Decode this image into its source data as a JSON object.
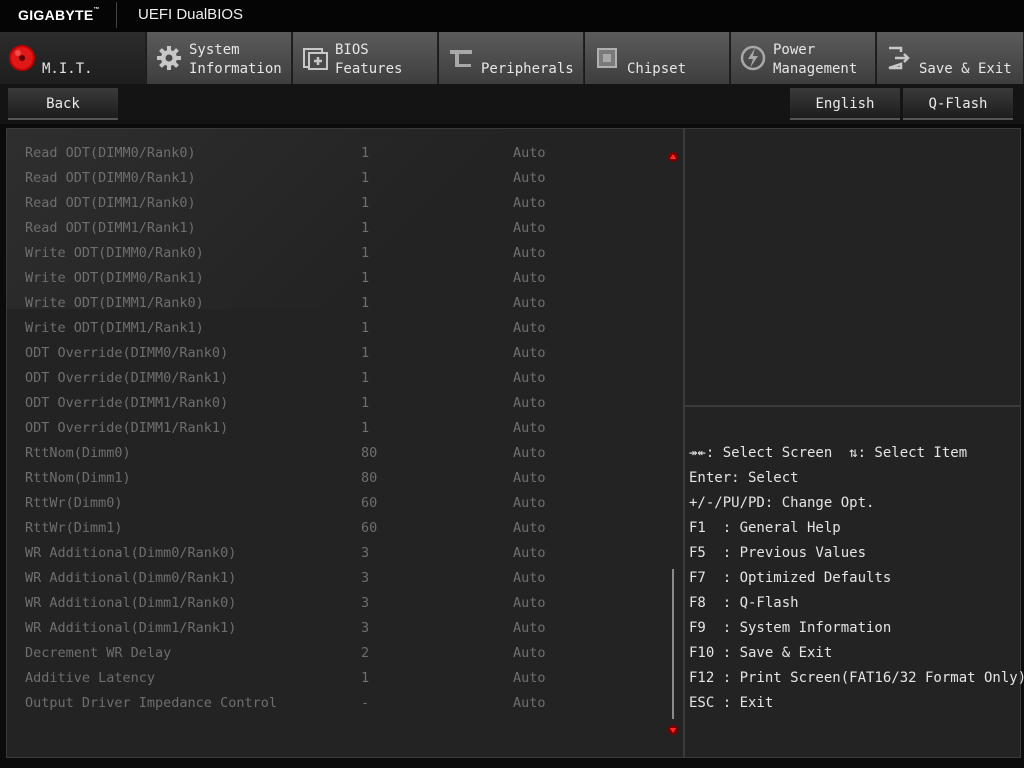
{
  "header": {
    "brand": "GIGABYTE",
    "brand_mark": "™",
    "product": "UEFI DualBIOS"
  },
  "tabs": [
    {
      "label1": "M.I.T.",
      "label2": "",
      "icon": "mit-disc-icon",
      "active": true
    },
    {
      "label1": "System",
      "label2": "Information",
      "icon": "gear-icon",
      "active": false
    },
    {
      "label1": "BIOS",
      "label2": "Features",
      "icon": "bios-chip-icon",
      "active": false
    },
    {
      "label1": "Peripherals",
      "label2": "",
      "icon": "peripherals-icon",
      "active": false
    },
    {
      "label1": "Chipset",
      "label2": "",
      "icon": "chipset-icon",
      "active": false
    },
    {
      "label1": "Power",
      "label2": "Management",
      "icon": "power-icon",
      "active": false
    },
    {
      "label1": "Save & Exit",
      "label2": "",
      "icon": "exit-icon",
      "active": false
    }
  ],
  "subbar": {
    "back_label": "Back",
    "language_label": "English",
    "qflash_label": "Q-Flash"
  },
  "settings": [
    {
      "name": "Read ODT(DIMM0/Rank0)",
      "current": "1",
      "setting": "Auto"
    },
    {
      "name": "Read ODT(DIMM0/Rank1)",
      "current": "1",
      "setting": "Auto"
    },
    {
      "name": "Read ODT(DIMM1/Rank0)",
      "current": "1",
      "setting": "Auto"
    },
    {
      "name": "Read ODT(DIMM1/Rank1)",
      "current": "1",
      "setting": "Auto"
    },
    {
      "name": "Write ODT(DIMM0/Rank0)",
      "current": "1",
      "setting": "Auto"
    },
    {
      "name": "Write ODT(DIMM0/Rank1)",
      "current": "1",
      "setting": "Auto"
    },
    {
      "name": "Write ODT(DIMM1/Rank0)",
      "current": "1",
      "setting": "Auto"
    },
    {
      "name": "Write ODT(DIMM1/Rank1)",
      "current": "1",
      "setting": "Auto"
    },
    {
      "name": "ODT Override(DIMM0/Rank0)",
      "current": "1",
      "setting": "Auto"
    },
    {
      "name": "ODT Override(DIMM0/Rank1)",
      "current": "1",
      "setting": "Auto"
    },
    {
      "name": "ODT Override(DIMM1/Rank0)",
      "current": "1",
      "setting": "Auto"
    },
    {
      "name": "ODT Override(DIMM1/Rank1)",
      "current": "1",
      "setting": "Auto"
    },
    {
      "name": "RttNom(Dimm0)",
      "current": "80",
      "setting": "Auto"
    },
    {
      "name": "RttNom(Dimm1)",
      "current": "80",
      "setting": "Auto"
    },
    {
      "name": "RttWr(Dimm0)",
      "current": "60",
      "setting": "Auto"
    },
    {
      "name": "RttWr(Dimm1)",
      "current": "60",
      "setting": "Auto"
    },
    {
      "name": "WR Additional(Dimm0/Rank0)",
      "current": "3",
      "setting": "Auto"
    },
    {
      "name": "WR Additional(Dimm0/Rank1)",
      "current": "3",
      "setting": "Auto"
    },
    {
      "name": "WR Additional(Dimm1/Rank0)",
      "current": "3",
      "setting": "Auto"
    },
    {
      "name": "WR Additional(Dimm1/Rank1)",
      "current": "3",
      "setting": "Auto"
    },
    {
      "name": "Decrement WR Delay",
      "current": "2",
      "setting": "Auto"
    },
    {
      "name": "Additive Latency",
      "current": "1",
      "setting": "Auto"
    },
    {
      "name": "Output Driver Impedance Control",
      "current": "-",
      "setting": "Auto"
    }
  ],
  "help": [
    {
      "text": "↠↞: Select Screen  ⇅: Select Item"
    },
    {
      "text": "Enter: Select"
    },
    {
      "text": "+/-/PU/PD: Change Opt."
    },
    {
      "text": "F1  : General Help"
    },
    {
      "text": "F5  : Previous Values"
    },
    {
      "text": "F7  : Optimized Defaults"
    },
    {
      "text": "F8  : Q-Flash"
    },
    {
      "text": "F9  : System Information"
    },
    {
      "text": "F10 : Save & Exit"
    },
    {
      "text": "F12 : Print Screen(FAT16/32 Format Only)"
    },
    {
      "text": "ESC : Exit"
    }
  ],
  "colors": {
    "accent_red": "#e01010",
    "text_dim": "#6e6e6e",
    "text_bright": "#e4e4e4"
  }
}
